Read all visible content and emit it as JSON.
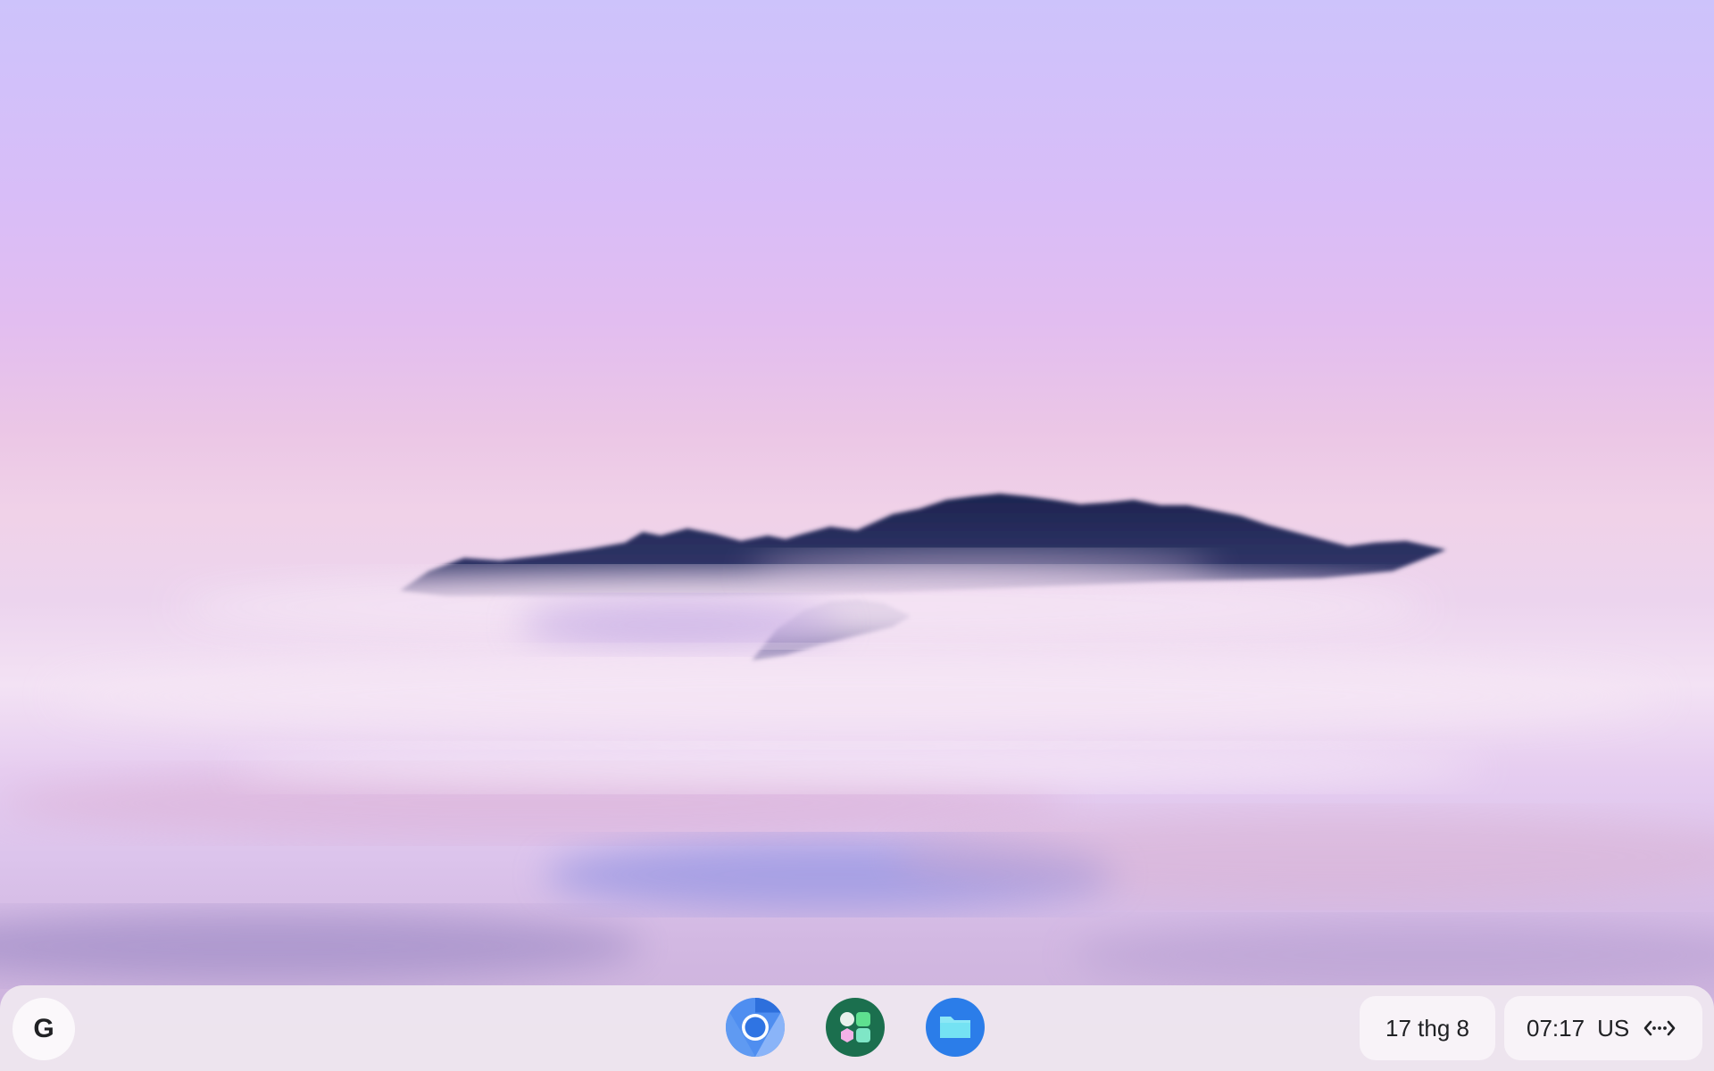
{
  "wallpaper": {
    "sky_top": "#cdc3fb",
    "sky_mid": "#e2bdf0",
    "mist": "#f3e2f4",
    "mountain": "#232a55"
  },
  "shelf": {
    "launcher": {
      "icon": "google-g-icon",
      "label": "G"
    },
    "apps": [
      {
        "name": "Chromium",
        "icon": "chromium-icon",
        "color": "#3b7be8"
      },
      {
        "name": "App store",
        "icon": "apps-grid-icon",
        "color": "#1b6f4e"
      },
      {
        "name": "Files",
        "icon": "folder-icon",
        "color": "#2b7de9"
      }
    ],
    "date": "17 thg 8",
    "time": "07:17",
    "keyboard_layout": "US",
    "network_icon": "ethernet-icon"
  }
}
